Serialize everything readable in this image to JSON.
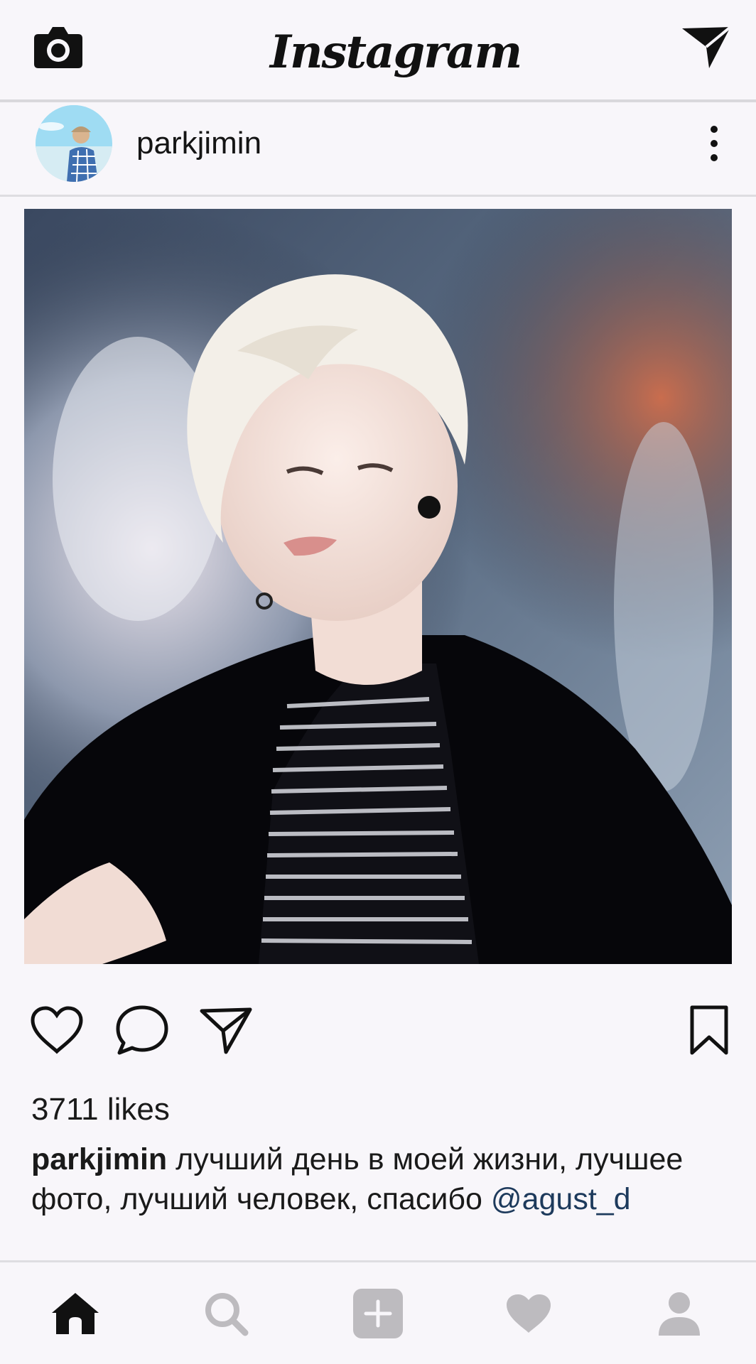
{
  "header": {
    "logo_text": "Instagram",
    "camera_icon": "camera-icon",
    "direct_icon": "paper-plane-icon"
  },
  "post": {
    "username": "parkjimin",
    "likes_text": "3711 likes",
    "caption_user": "parkjimin",
    "caption_text": " лучший день в моей жизни, лучшее фото, лучший человек, спасибо ",
    "caption_mention": "@agust_d"
  },
  "bottom_nav": {
    "items": [
      "home-icon",
      "search-icon",
      "add-post-icon",
      "activity-heart-icon",
      "profile-icon"
    ],
    "active": "home-icon"
  },
  "colors": {
    "background": "#f8f6fa",
    "mention": "#1d3a5c",
    "inactive_icon": "#bdbbbf",
    "active_icon": "#111111"
  }
}
